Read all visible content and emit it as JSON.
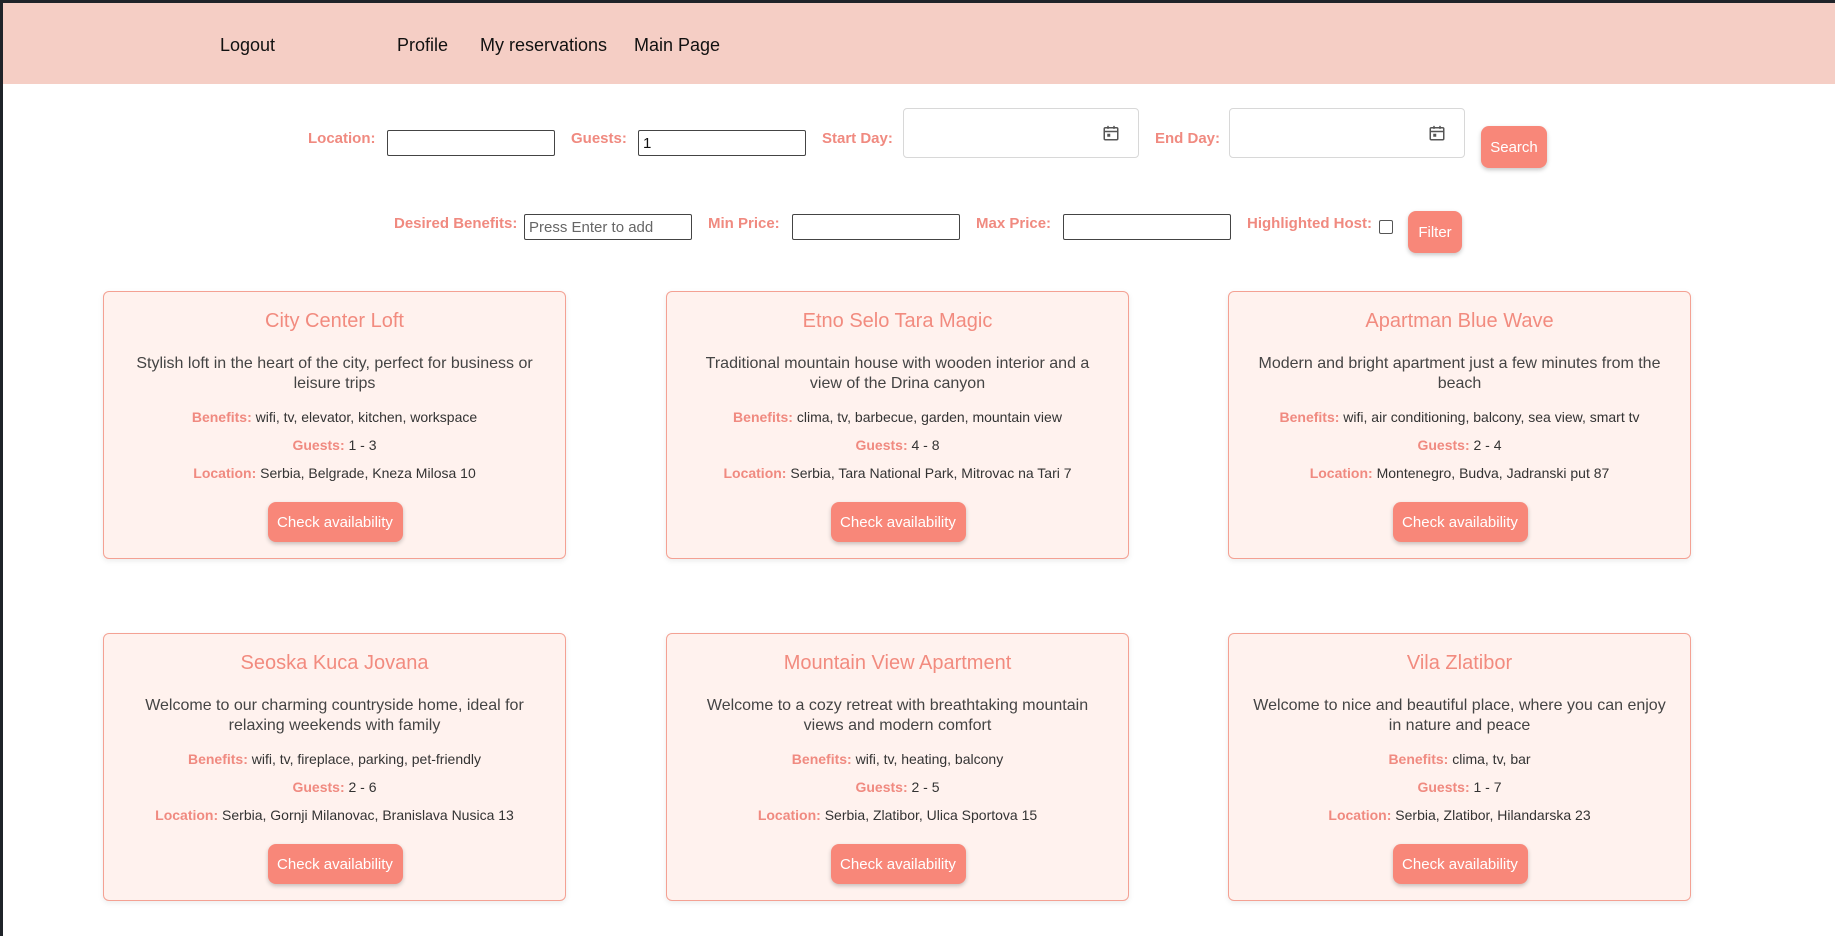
{
  "nav": {
    "logout": "Logout",
    "profile": "Profile",
    "my_reservations": "My reservations",
    "main_page": "Main Page"
  },
  "search": {
    "location_label": "Location:",
    "location_value": "",
    "guests_label": "Guests:",
    "guests_value": "1",
    "start_label": "Start Day:",
    "end_label": "End Day:",
    "search_button": "Search"
  },
  "filter": {
    "benefits_label": "Desired Benefits:",
    "benefits_placeholder": "Press Enter to add",
    "min_price_label": "Min Price:",
    "max_price_label": "Max Price:",
    "highlighted_label": "Highlighted Host:",
    "highlighted_checked": false,
    "filter_button": "Filter"
  },
  "labels": {
    "benefits": "Benefits:",
    "guests": "Guests:",
    "location": "Location:"
  },
  "accommodations": [
    {
      "name": "City Center Loft",
      "description": "Stylish loft in the heart of the city, perfect for business or leisure trips",
      "benefits": "wifi, tv, elevator, kitchen, workspace",
      "guests": "1 - 3",
      "location": "Serbia, Belgrade, Kneza Milosa 10",
      "button": "Check availability"
    },
    {
      "name": "Etno Selo Tara Magic",
      "description": "Traditional mountain house with wooden interior and a view of the Drina canyon",
      "benefits": "clima, tv, barbecue, garden, mountain view",
      "guests": "4 - 8",
      "location": "Serbia, Tara National Park, Mitrovac na Tari 7",
      "button": "Check availability"
    },
    {
      "name": "Apartman Blue Wave",
      "description": "Modern and bright apartment just a few minutes from the beach",
      "benefits": "wifi, air conditioning, balcony, sea view, smart tv",
      "guests": "2 - 4",
      "location": "Montenegro, Budva, Jadranski put 87",
      "button": "Check availability"
    },
    {
      "name": "Seoska Kuca Jovana",
      "description": "Welcome to our charming countryside home, ideal for relaxing weekends with family",
      "benefits": "wifi, tv, fireplace, parking, pet-friendly",
      "guests": "2 - 6",
      "location": "Serbia, Gornji Milanovac, Branislava Nusica 13",
      "button": "Check availability"
    },
    {
      "name": "Mountain View Apartment",
      "description": "Welcome to a cozy retreat with breathtaking mountain views and modern comfort",
      "benefits": "wifi, tv, heating, balcony",
      "guests": "2 - 5",
      "location": "Serbia, Zlatibor, Ulica Sportova 15",
      "button": "Check availability"
    },
    {
      "name": "Vila Zlatibor",
      "description": "Welcome to nice and beautiful place, where you can enjoy in nature and peace",
      "benefits": "clima, tv, bar",
      "guests": "1 - 7",
      "location": "Serbia, Zlatibor, Hilandarska 23",
      "button": "Check availability"
    }
  ],
  "colors": {
    "navbar": "#f5cec5",
    "accent": "#f88779",
    "label": "#f08a80",
    "card_bg": "#fff2ee",
    "card_border": "#f4a193"
  }
}
